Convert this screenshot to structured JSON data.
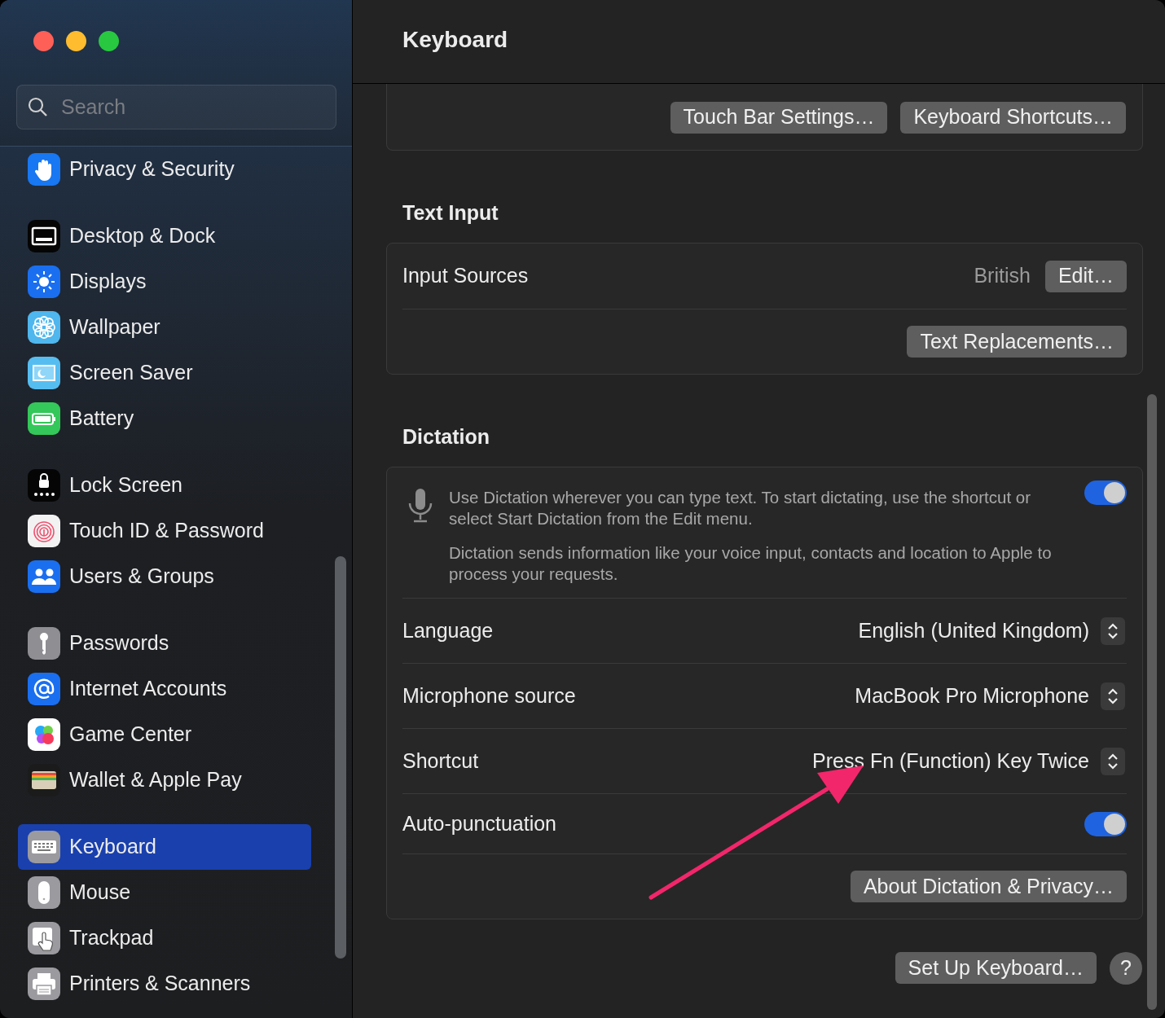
{
  "window": {
    "title": "Keyboard"
  },
  "sidebar": {
    "search": {
      "placeholder": "Search"
    },
    "groups": [
      {
        "items": [
          {
            "label": "Privacy & Security",
            "selected": false
          }
        ]
      },
      {
        "items": [
          {
            "label": "Desktop & Dock",
            "selected": false
          },
          {
            "label": "Displays",
            "selected": false
          },
          {
            "label": "Wallpaper",
            "selected": false
          },
          {
            "label": "Screen Saver",
            "selected": false
          },
          {
            "label": "Battery",
            "selected": false
          }
        ]
      },
      {
        "items": [
          {
            "label": "Lock Screen",
            "selected": false
          },
          {
            "label": "Touch ID & Password",
            "selected": false
          },
          {
            "label": "Users & Groups",
            "selected": false
          }
        ]
      },
      {
        "items": [
          {
            "label": "Passwords",
            "selected": false
          },
          {
            "label": "Internet Accounts",
            "selected": false
          },
          {
            "label": "Game Center",
            "selected": false
          },
          {
            "label": "Wallet & Apple Pay",
            "selected": false
          }
        ]
      },
      {
        "items": [
          {
            "label": "Keyboard",
            "selected": true
          },
          {
            "label": "Mouse",
            "selected": false
          },
          {
            "label": "Trackpad",
            "selected": false
          },
          {
            "label": "Printers & Scanners",
            "selected": false
          }
        ]
      }
    ]
  },
  "content": {
    "top_card": {
      "buttons": [
        "Touch Bar Settings…",
        "Keyboard Shortcuts…"
      ]
    },
    "sections": [
      {
        "title": "Text Input",
        "rows": [
          {
            "kind": "value_button",
            "label": "Input Sources",
            "value": "British",
            "button": "Edit…"
          },
          {
            "kind": "button",
            "button": "Text Replacements…"
          }
        ]
      },
      {
        "title": "Dictation",
        "rows": [
          {
            "kind": "description",
            "paragraphs": [
              "Use Dictation wherever you can type text. To start dictating, use the shortcut or select Start Dictation from the Edit menu.",
              "Dictation sends information like your voice input, contacts and location to Apple to process your requests."
            ],
            "on": true
          },
          {
            "kind": "popup",
            "label": "Language",
            "value": "English (United Kingdom)"
          },
          {
            "kind": "popup",
            "label": "Microphone source",
            "value": "MacBook Pro Microphone"
          },
          {
            "kind": "popup",
            "label": "Shortcut",
            "value": "Press Fn (Function) Key Twice"
          },
          {
            "kind": "toggle",
            "label": "Auto-punctuation",
            "on": true
          },
          {
            "kind": "button",
            "button": "About Dictation & Privacy…"
          }
        ]
      }
    ],
    "footer": {
      "buttons": [
        "Set Up Keyboard…"
      ],
      "help": "?"
    }
  }
}
